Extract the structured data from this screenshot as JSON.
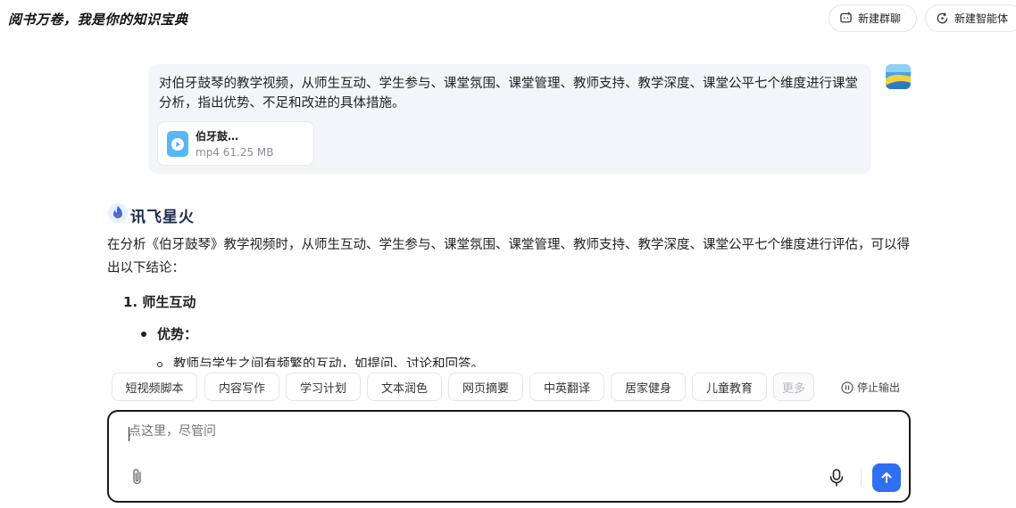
{
  "header": {
    "title": "阅书万卷，我是你的知识宝典",
    "new_group_chat": "新建群聊",
    "new_agent": "新建智能体"
  },
  "user_message": {
    "text": "对伯牙鼓琴的教学视频，从师生互动、学生参与、课堂氛围、课堂管理、教师支持、教学深度、课堂公平七个维度进行课堂分析，指出优势、不足和改进的具体措施。",
    "file": {
      "name": "伯牙鼓…",
      "meta": "mp4 61.25 MB"
    }
  },
  "assistant": {
    "brand": "讯飞星火",
    "intro": "在分析《伯牙鼓琴》教学视频时，从师生互动、学生参与、课堂氛围、课堂管理、教师支持、教学深度、课堂公平七个维度进行评估，可以得出以下结论：",
    "item1": "1. 师生互动",
    "item1_bullet": "优势：",
    "item1_sub": "教师与学生之间有频繁的互动，如提问、讨论和回答。"
  },
  "quick_chips": [
    "短视频脚本",
    "内容写作",
    "学习计划",
    "文本润色",
    "网页摘要",
    "中英翻译",
    "居家健身",
    "儿童教育",
    "更多"
  ],
  "stop_output": "停止输出",
  "input": {
    "placeholder": "点这里，尽管问"
  },
  "colors": {
    "accent": "#2f6ff3",
    "bubble": "#f4f5f9",
    "file_icon": "#57b7f6"
  }
}
